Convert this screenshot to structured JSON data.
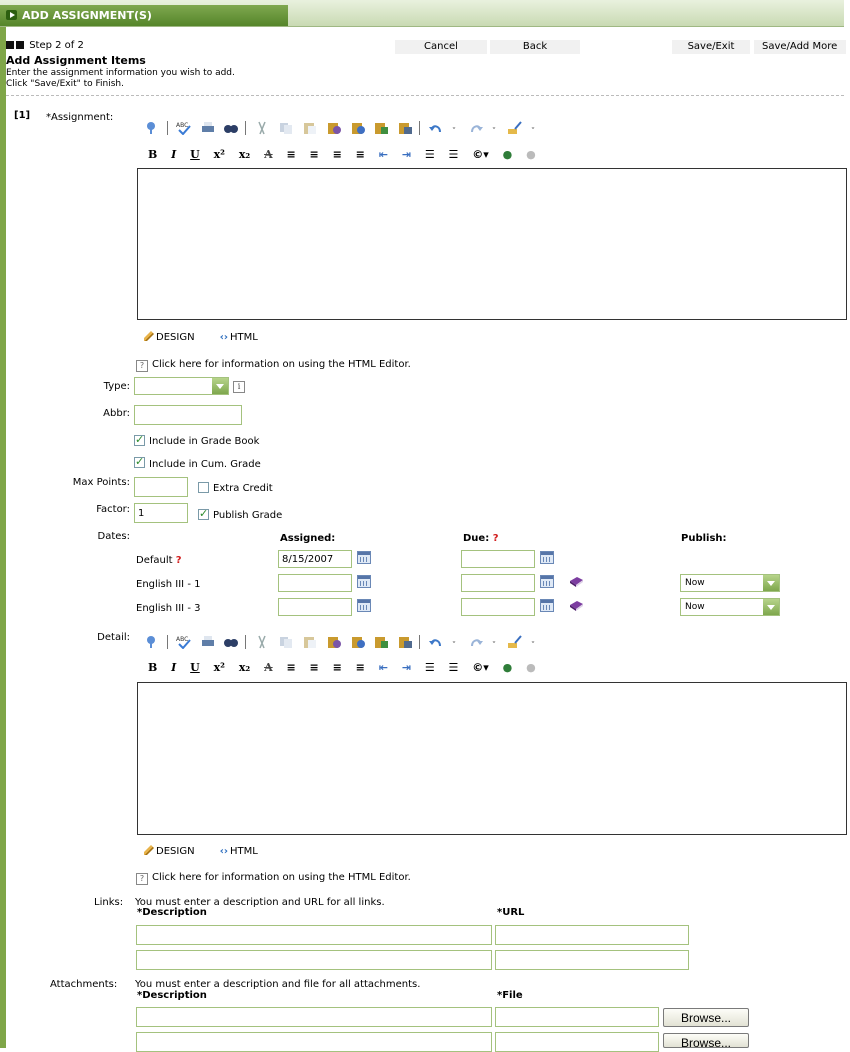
{
  "header": {
    "title": "ADD ASSIGNMENT(S)"
  },
  "step": {
    "text": "Step 2 of 2"
  },
  "commands": {
    "cancel": "Cancel",
    "back": "Back",
    "save_exit": "Save/Exit",
    "save_add_more": "Save/Add More"
  },
  "page": {
    "heading": "Add Assignment Items",
    "intro1": "Enter the assignment information you wish to add.",
    "intro2": "Click \"Save/Exit\" to Finish."
  },
  "item": {
    "index": "[1]",
    "assignment_label": "*Assignment:",
    "editor_modes": {
      "design": "DESIGN",
      "html": "HTML"
    },
    "help_text": "Click here for information on using the HTML Editor.",
    "type_label": "Type:",
    "abbr_label": "Abbr:",
    "include_grade_book": "Include in Grade Book",
    "include_cum_grade": "Include in Cum. Grade",
    "max_points_label": "Max Points:",
    "extra_credit": "Extra Credit",
    "factor_label": "Factor:",
    "factor_value": "1",
    "publish_grade": "Publish Grade",
    "dates_label": "Dates:",
    "dates": {
      "col_assigned": "Assigned:",
      "col_due": "Due:",
      "col_publish": "Publish:",
      "req_mark": "?",
      "rows": [
        {
          "name": "Default",
          "assigned": "8/15/2007",
          "due": "",
          "publish": ""
        },
        {
          "name": "English III - 1",
          "assigned": "",
          "due": "",
          "publish": "Now"
        },
        {
          "name": "English III - 3",
          "assigned": "",
          "due": "",
          "publish": "Now"
        }
      ]
    },
    "detail_label": "Detail:",
    "links_label": "Links:",
    "links_note": "You must enter a description and URL for all links.",
    "links_cols": {
      "description": "*Description",
      "url": "*URL"
    },
    "attachments_label": "Attachments:",
    "attachments_note": "You must enter a description and file for all attachments.",
    "attachments_cols": {
      "description": "*Description",
      "file": "*File"
    },
    "browse_label": "Browse..."
  },
  "toolbar_icons": [
    "spellcheck-icon",
    "abc-check-icon",
    "print-icon",
    "find-icon",
    "cut-icon",
    "copy-icon",
    "paste-icon",
    "paste-text-icon",
    "paste-word-icon",
    "paste-html-icon",
    "paste-special-icon",
    "undo-icon",
    "redo-icon",
    "format-brush-icon"
  ],
  "format_icons": [
    "bold-icon",
    "italic-icon",
    "underline-icon",
    "superscript-icon",
    "subscript-icon",
    "strikethrough-icon",
    "align-left-icon",
    "align-center-icon",
    "align-right-icon",
    "justify-icon",
    "outdent-icon",
    "indent-icon",
    "numbered-list-icon",
    "bullet-list-icon",
    "symbol-icon",
    "insert-link-icon",
    "remove-link-icon"
  ],
  "colors": {
    "accent": "#6c9a3c",
    "field_border": "#a4c27e",
    "required": "#d21d1d"
  }
}
